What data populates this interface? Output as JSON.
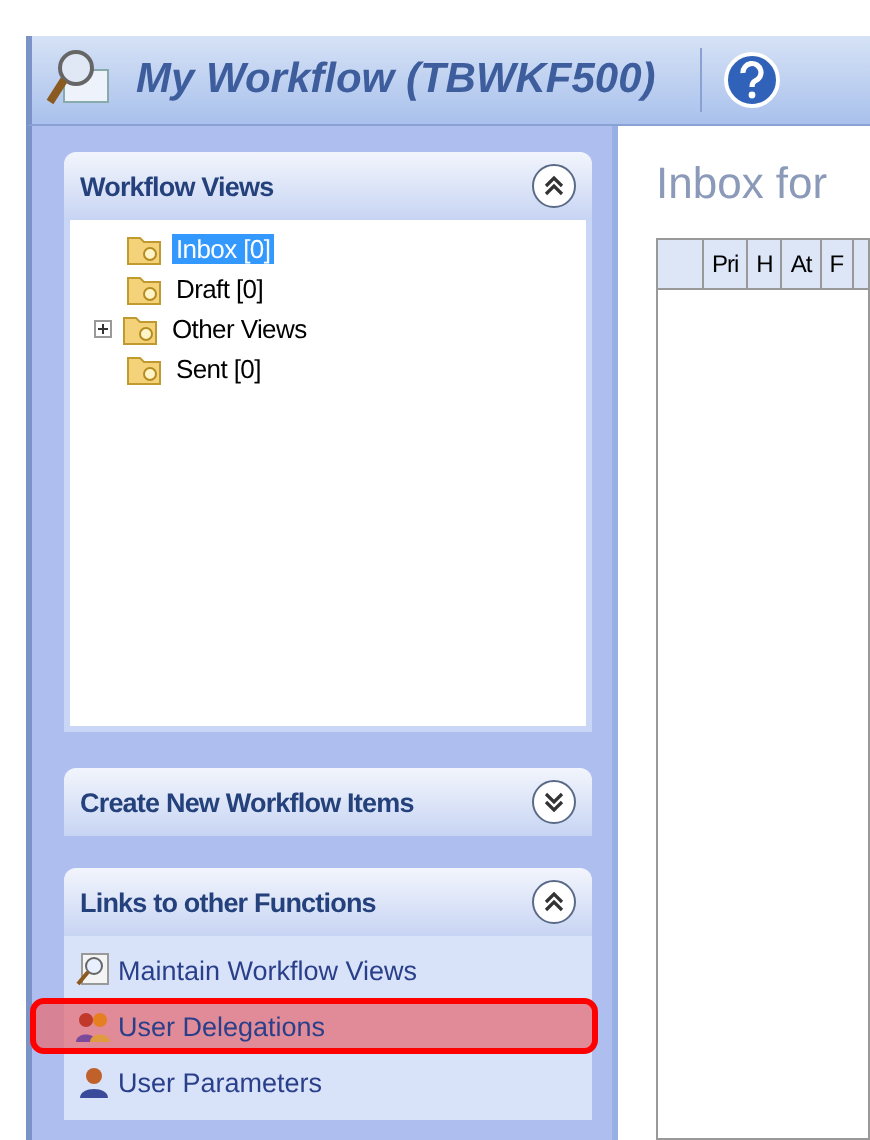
{
  "window": {
    "title": "My Workflow (TBWKF500)"
  },
  "sidebar": {
    "sections": [
      {
        "title": "Workflow Views",
        "expanded": true,
        "kind": "tree",
        "tree": [
          {
            "label": "Inbox [0]",
            "selected": true,
            "kind": "leaf"
          },
          {
            "label": "Draft [0]",
            "selected": false,
            "kind": "leaf"
          },
          {
            "label": "Other Views",
            "selected": false,
            "kind": "group",
            "expanded": false
          },
          {
            "label": "Sent [0]",
            "selected": false,
            "kind": "leaf"
          }
        ]
      },
      {
        "title": "Create New Workflow Items",
        "expanded": false,
        "kind": "links"
      },
      {
        "title": "Links to other Functions",
        "expanded": true,
        "kind": "links",
        "links": [
          {
            "label": "Maintain Workflow Views",
            "highlighted": false
          },
          {
            "label": "User Delegations",
            "highlighted": true
          },
          {
            "label": "User Parameters",
            "highlighted": false
          }
        ]
      }
    ]
  },
  "content": {
    "heading": "Inbox for",
    "table": {
      "columns": [
        "",
        "Pri",
        "H",
        "At",
        "F"
      ]
    }
  }
}
